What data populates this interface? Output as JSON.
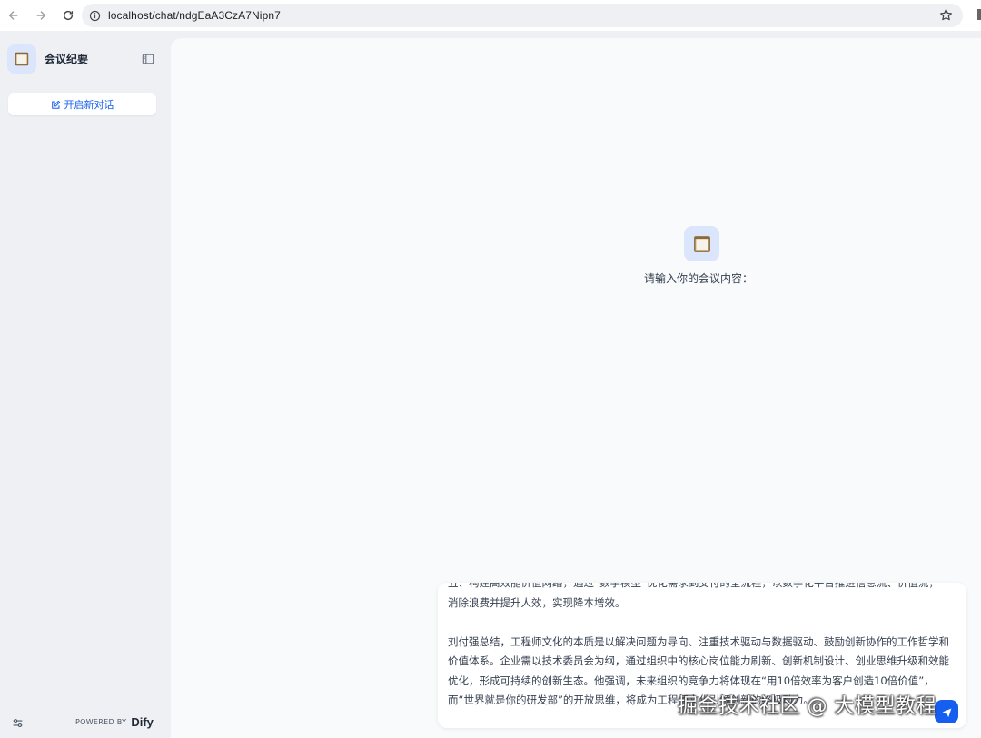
{
  "browser": {
    "url": "localhost/chat/ndgEaA3CzA7Nipn7"
  },
  "sidebar": {
    "app_title": "会议纪要",
    "new_chat_label": "开启新对话",
    "powered_by": "POWERED BY",
    "brand": "Dify"
  },
  "main": {
    "prompt_text": "请输入你的会议内容：",
    "input_value": "丑、构建高效能价值网络，通过“数字模型”优化需求到交付的全流程，以数字化平台推进信息流、价值流，\n消除浪费并提升人效，实现降本增效。\n\n刘付强总结，工程师文化的本质是以解决问题为导向、注重技术驱动与数据驱动、鼓励创新协作的工作哲学和价值体系。企业需以技术委员会为纲，通过组织中的核心岗位能力刷新、创新机制设计、创业思维升级和效能优化，形成可持续的创新生态。他强调，未来组织的竞争力将体现在“用10倍效率为客户创造10倍价值”，而“世界就是你的研发部”的开放思维，将成为工程师文化引领创新的终极动力。"
  },
  "watermark": "掘金技术社区 @ 大模型教程",
  "colors": {
    "accent": "#155eef",
    "sidebar_bg": "#eef0f4",
    "main_bg": "#f9fafb"
  }
}
